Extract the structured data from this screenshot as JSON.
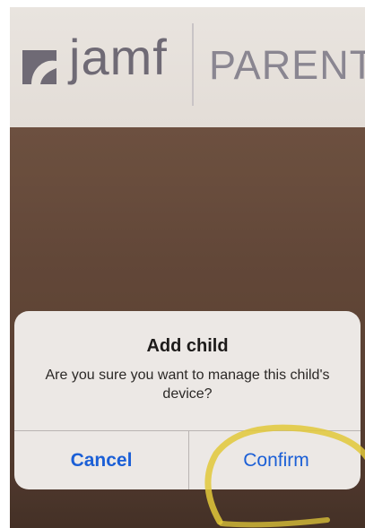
{
  "header": {
    "brand_name": "jamf",
    "brand_suffix": "PARENT"
  },
  "dialog": {
    "title": "Add child",
    "message": "Are you sure you want to manage this child's device?",
    "cancel_label": "Cancel",
    "confirm_label": "Confirm"
  },
  "colors": {
    "button_text": "#1b5fd6",
    "dialog_background": "#ece8e5",
    "backdrop": "#6a4d3e",
    "highlight_marker": "#e2c83a"
  }
}
